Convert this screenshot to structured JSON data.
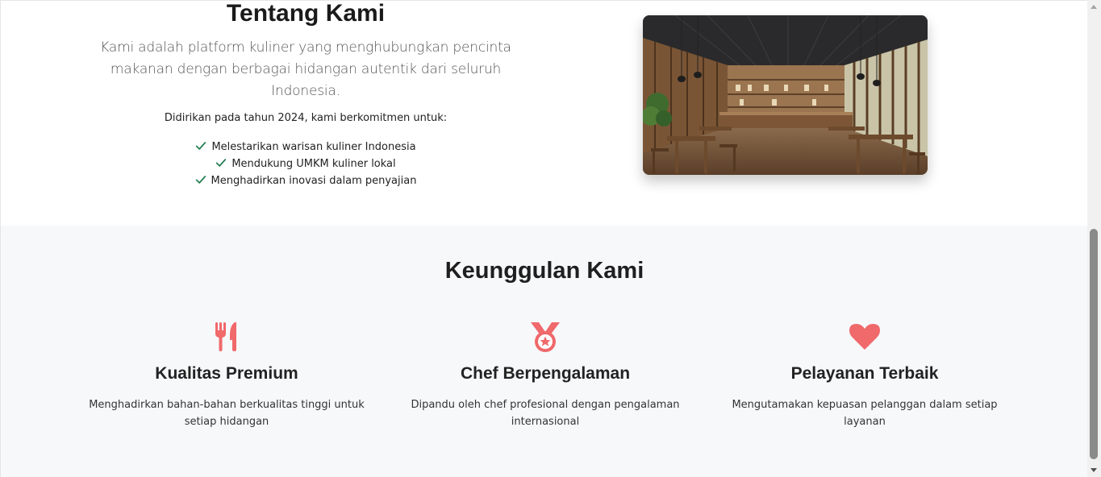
{
  "about": {
    "title": "Tentang Kami",
    "description": "Kami adalah platform kuliner yang menghubungkan pencinta makanan dengan berbagai hidangan autentik dari seluruh Indonesia.",
    "founded_text": "Didirikan pada tahun 2024, kami berkomitmen untuk:",
    "commitments": [
      "Melestarikan warisan kuliner Indonesia",
      "Mendukung UMKM kuliner lokal",
      "Menghadirkan inovasi dalam penyajian"
    ],
    "image_icon": "restaurant-interior-image",
    "check_color": "#1e7a4c"
  },
  "features": {
    "title": "Keunggulan Kami",
    "accent_color": "#f0696b",
    "items": [
      {
        "icon": "utensils-icon",
        "title": "Kualitas Premium",
        "description": "Menghadirkan bahan-bahan berkualitas tinggi untuk setiap hidangan"
      },
      {
        "icon": "medal-icon",
        "title": "Chef Berpengalaman",
        "description": "Dipandu oleh chef profesional dengan pengalaman internasional"
      },
      {
        "icon": "heart-icon",
        "title": "Pelayanan Terbaik",
        "description": "Mengutamakan kepuasan pelanggan dalam setiap layanan"
      }
    ]
  },
  "colors": {
    "features_background": "#f7f8fa",
    "heading": "#1a1a1a"
  }
}
